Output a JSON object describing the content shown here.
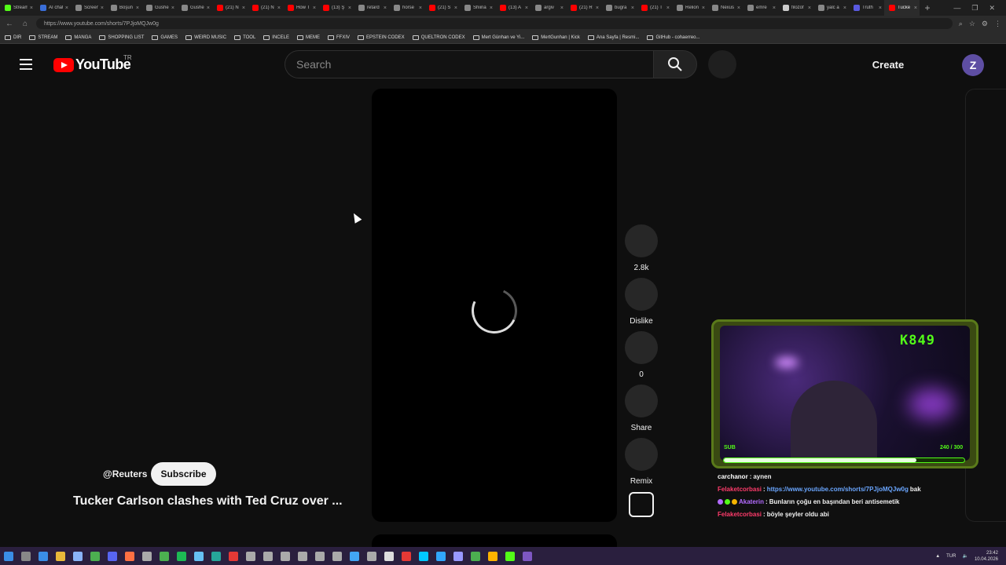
{
  "browser": {
    "tabs": [
      {
        "label": "Stream",
        "color": "#53fc18"
      },
      {
        "label": "AI chat",
        "color": "#3a6ed8"
      },
      {
        "label": "Screen",
        "color": "#888888"
      },
      {
        "label": "Boşun",
        "color": "#888888"
      },
      {
        "label": "Gushe",
        "color": "#888888"
      },
      {
        "label": "Gushe",
        "color": "#888888"
      },
      {
        "label": "(21) N",
        "color": "#ff0000"
      },
      {
        "label": "(21) N",
        "color": "#ff0000"
      },
      {
        "label": "How T",
        "color": "#ff0000"
      },
      {
        "label": "(13) Ş",
        "color": "#ff0000"
      },
      {
        "label": "retard",
        "color": "#888888"
      },
      {
        "label": "horse",
        "color": "#888888"
      },
      {
        "label": "(21) S",
        "color": "#ff0000"
      },
      {
        "label": "Shiina",
        "color": "#888888"
      },
      {
        "label": "(13) A",
        "color": "#ff0000"
      },
      {
        "label": "argiv",
        "color": "#888888"
      },
      {
        "label": "(21) R",
        "color": "#ff0000"
      },
      {
        "label": "bugra",
        "color": "#888888"
      },
      {
        "label": "(21) T",
        "color": "#ff0000"
      },
      {
        "label": "Relion",
        "color": "#888888"
      },
      {
        "label": "Nexus",
        "color": "#888888"
      },
      {
        "label": "emre",
        "color": "#888888"
      },
      {
        "label": "filozof",
        "color": "#cccccc"
      },
      {
        "label": "yalc a",
        "color": "#888888"
      },
      {
        "label": "Truth",
        "color": "#5a5ae0"
      },
      {
        "label": "Tucke",
        "color": "#ff0000",
        "active": true
      }
    ],
    "url": "https://www.youtube.com/shorts/7PJjoMQJw0g",
    "bookmarks": [
      "DIR",
      "STREAM",
      "MANGA",
      "SHOPPING LIST",
      "GAMES",
      "WEIRD MUSIC",
      "TOOL",
      "INCELE",
      "MEME",
      "FFXIV",
      "EPSTEIN CODEX",
      "QUELTRON CODEX",
      "Mert Günhan ve Yi...",
      "MertGunhan | Kick",
      "Ana Sayfa | Resmi...",
      "GitHub - cohaerreo..."
    ]
  },
  "header": {
    "logo_text": "YouTube",
    "country_code": "TR",
    "search_placeholder": "Search",
    "create_label": "Create",
    "avatar_letter": "Z"
  },
  "actions": {
    "like_count": "2.8k",
    "dislike_label": "Dislike",
    "comments_count": "0",
    "share_label": "Share",
    "remix_label": "Remix"
  },
  "video": {
    "channel": "@Reuters",
    "subscribe_label": "Subscribe",
    "title": "Tucker Carlson clashes with Ted Cruz over ..."
  },
  "overlay": {
    "score": "K849",
    "sub_label": "SUB",
    "sub_count": "240 / 300",
    "sub_progress": 0.8,
    "accent": "#53fc18"
  },
  "chat": [
    {
      "user": "carchanor",
      "user_color": "#ffffff",
      "parts": [
        {
          "t": "aynen"
        }
      ]
    },
    {
      "user": "Felaketcorbasi",
      "user_color": "#ff3b6b",
      "parts": [
        {
          "t": "https://www.youtube.com/shorts/7PJjoMQJw0g",
          "link": true
        },
        {
          "t": "bak"
        }
      ]
    },
    {
      "user": "Akaterin",
      "user_color": "#b36bff",
      "badges": true,
      "parts": [
        {
          "t": "Bunların çoğu en başından beri antisemetik"
        }
      ]
    },
    {
      "user": "Felaketcorbasi",
      "user_color": "#ff3b6b",
      "parts": [
        {
          "t": "böyle şeyler oldu abi"
        }
      ]
    }
  ],
  "taskbar": {
    "language": "TUR",
    "time": "23:42",
    "date": "10.04.2026"
  }
}
